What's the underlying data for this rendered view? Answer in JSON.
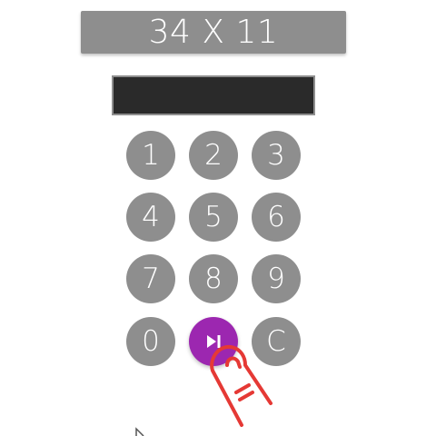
{
  "problem": {
    "text": "34 X 11"
  },
  "answer": {
    "value": ""
  },
  "keypad": {
    "keys": [
      "1",
      "2",
      "3",
      "4",
      "5",
      "6",
      "7",
      "8",
      "9",
      "0"
    ],
    "submit_icon": "skip-next-icon",
    "clear_label": "C"
  },
  "colors": {
    "key_gray": "#8e8e8e",
    "answer_bg": "#2a2a2a",
    "submit_purple": "#9c27b0",
    "hint_red": "#e53935"
  },
  "hint": {
    "icon": "tap-hand-icon"
  }
}
